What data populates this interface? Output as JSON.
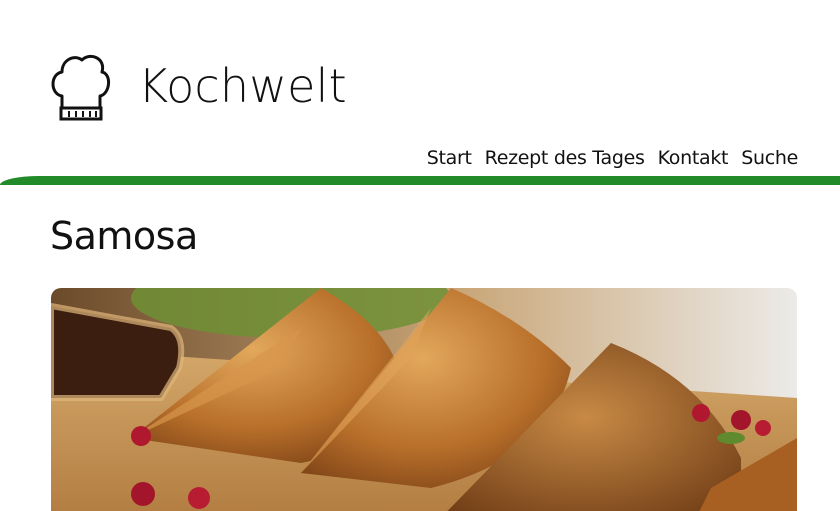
{
  "header": {
    "brand": "Kochwelt",
    "logo_icon": "chef-hat-icon"
  },
  "nav": {
    "items": [
      {
        "label": "Start"
      },
      {
        "label": "Rezept des Tages"
      },
      {
        "label": "Kontakt"
      },
      {
        "label": "Suche"
      }
    ]
  },
  "main": {
    "title": "Samosa",
    "hero_image": "samosa-photo"
  },
  "colors": {
    "accent": "#238a2a"
  }
}
